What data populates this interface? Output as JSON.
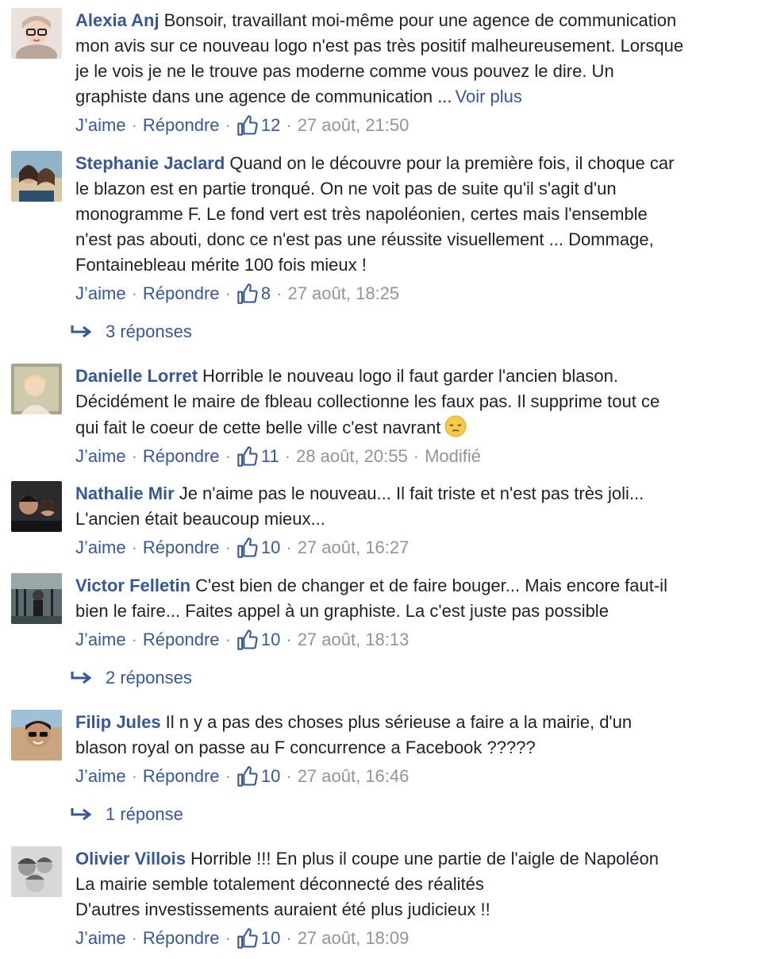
{
  "comments": [
    {
      "author": "Alexia Anj",
      "text": "Bonsoir, travaillant moi-même pour une agence de communication\nmon avis sur ce nouveau logo n'est pas très positif malheureusement. Lorsque\nje le vois je ne le trouve pas moderne comme vous pouvez le dire. Un\ngraphiste dans une agence de communication ...",
      "see_more": "Voir plus",
      "like_label": "J’aime",
      "reply_label": "Répondre",
      "like_count": "12",
      "timestamp": "27 août, 21:50"
    },
    {
      "author": "Stephanie Jaclard",
      "text": "Quand on le découvre pour la première fois, il choque car\nle blazon est en partie tronqué. On ne voit pas de suite qu'il s'agit d'un\nmonogramme F. Le fond vert est très napoléonien, certes mais l'ensemble\nn'est pas abouti, donc ce n'est pas une réussite visuellement ... Dommage,\nFontainebleau mérite 100 fois mieux !",
      "like_label": "J’aime",
      "reply_label": "Répondre",
      "like_count": "8",
      "timestamp": "27 août, 18:25",
      "replies_link": "3 réponses"
    },
    {
      "author": "Danielle Lorret",
      "text": "Horrible le nouveau logo il faut garder l'ancien blason.\nDécidément le maire de fbleau collectionne les faux pas. Il supprime tout ce\nqui fait le coeur de cette belle ville c'est navrant",
      "like_label": "J’aime",
      "reply_label": "Répondre",
      "like_count": "11",
      "timestamp": "28 août, 20:55",
      "edited": "Modifié"
    },
    {
      "author": "Nathalie Mir",
      "text": "Je n'aime pas le nouveau... Il fait triste et n'est pas très joli...\nL'ancien était beaucoup mieux...",
      "like_label": "J’aime",
      "reply_label": "Répondre",
      "like_count": "10",
      "timestamp": "27 août, 16:27"
    },
    {
      "author": "Victor Felletin",
      "text": "C'est bien de changer et de faire bouger... Mais encore faut-il\nbien le faire... Faites appel à un graphiste. La c'est juste pas possible",
      "like_label": "J’aime",
      "reply_label": "Répondre",
      "like_count": "10",
      "timestamp": "27 août, 18:13",
      "replies_link": "2 réponses"
    },
    {
      "author": "Filip Jules",
      "text": "Il n y a pas des choses plus sérieuse a faire a la mairie, d'un\nblason royal on passe au F concurrence a Facebook ?????",
      "like_label": "J’aime",
      "reply_label": "Répondre",
      "like_count": "10",
      "timestamp": "27 août, 16:46",
      "replies_link": "1 réponse"
    },
    {
      "author": "Olivier Villois",
      "text": "Horrible !!! En plus il coupe une partie de l'aigle de Napoléon\nLa mairie semble totalement déconnecté des réalités\nD'autres investissements auraient été plus judicieux !!",
      "like_label": "J’aime",
      "reply_label": "Répondre",
      "like_count": "10",
      "timestamp": "27 août, 18:09"
    }
  ],
  "separator": "·",
  "icons": {
    "like": "thumbs-up-icon",
    "reply_arrow": "reply-arrow-icon",
    "emoji": "pensive-face-icon"
  },
  "colors": {
    "link": "#365899",
    "meta": "#90949c",
    "text": "#1d2129"
  }
}
